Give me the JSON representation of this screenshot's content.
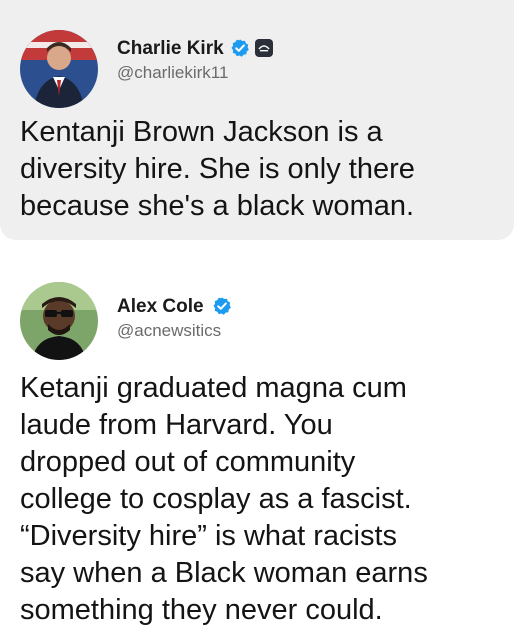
{
  "tweets": [
    {
      "author": {
        "name": "Charlie Kirk",
        "handle": "@charliekirk11",
        "verified": true,
        "affiliate_badge": true
      },
      "lines": [
        "Kentanji Brown Jackson is a",
        "diversity hire. She is only there",
        "because she's a black woman."
      ]
    },
    {
      "author": {
        "name": "Alex Cole",
        "handle": "@acnewsitics",
        "verified": true
      },
      "lines": [
        "Ketanji graduated magna cum",
        "laude from Harvard. You",
        "dropped out of community",
        "college to cosplay as a fascist.",
        "“Diversity hire” is what racists",
        "say when a Black woman earns",
        "something they never could."
      ]
    }
  ],
  "colors": {
    "verified_blue": "#1d9bf0",
    "quoted_card_bg": "#efefef",
    "handle_gray": "#6b6b6b"
  },
  "icons": [
    "verified-badge-icon",
    "affiliate-badge-icon"
  ]
}
